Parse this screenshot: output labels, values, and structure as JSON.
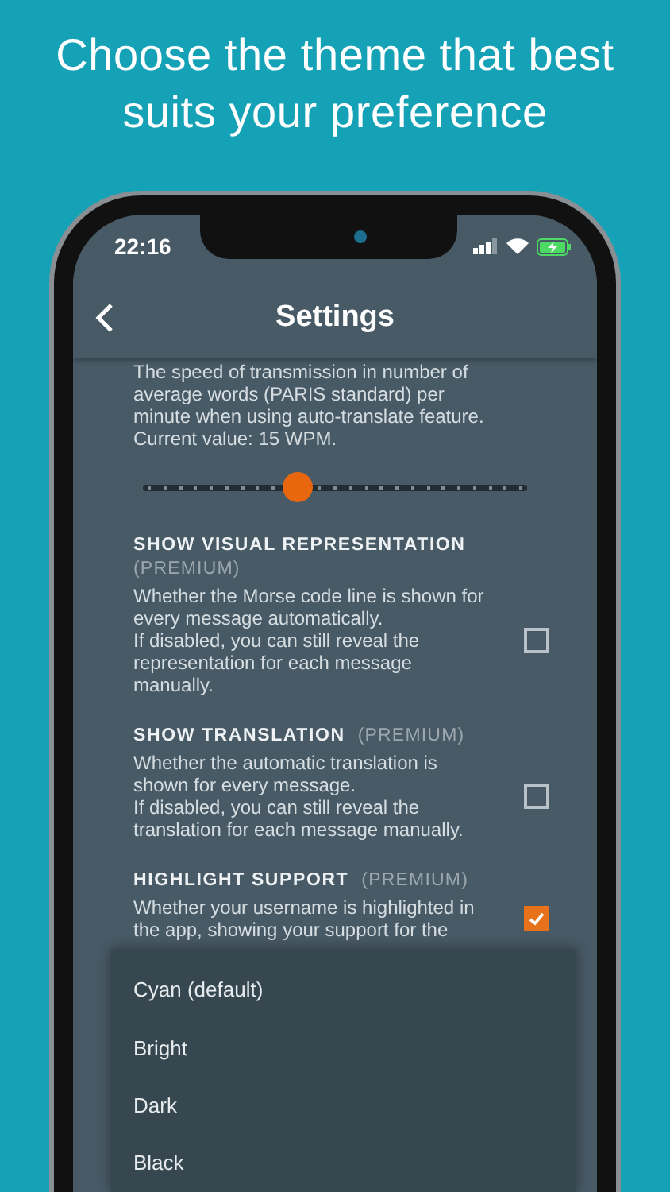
{
  "headline": "Choose the theme that best suits your preference",
  "status_bar": {
    "time": "22:16"
  },
  "header": {
    "title": "Settings"
  },
  "speed_setting": {
    "description": "The speed of transmission in number of average words (PARIS standard) per minute when using auto-translate feature. Current value: 15 WPM.",
    "level": 0.4
  },
  "settings": [
    {
      "title": "SHOW VISUAL REPRESENTATION",
      "premium_label": "(PREMIUM)",
      "paragraphs": [
        "Whether the Morse code line is shown for every message automatically.",
        "If disabled, you can still reveal the representation for each message manually."
      ],
      "checked": false
    },
    {
      "title": "SHOW TRANSLATION",
      "premium_label": "(PREMIUM)",
      "paragraphs": [
        "Whether the automatic translation is shown for every message.",
        "If disabled, you can still reveal the translation for each message manually."
      ],
      "checked": false
    },
    {
      "title": "HIGHLIGHT SUPPORT",
      "premium_label": "(PREMIUM)",
      "paragraphs": [
        "Whether your username is highlighted in the app, showing your support for the"
      ],
      "checked": true
    }
  ],
  "theme_menu": {
    "options": [
      {
        "label": "Cyan (default)"
      },
      {
        "label": "Bright"
      },
      {
        "label": "Dark"
      },
      {
        "label": "Black"
      }
    ]
  }
}
